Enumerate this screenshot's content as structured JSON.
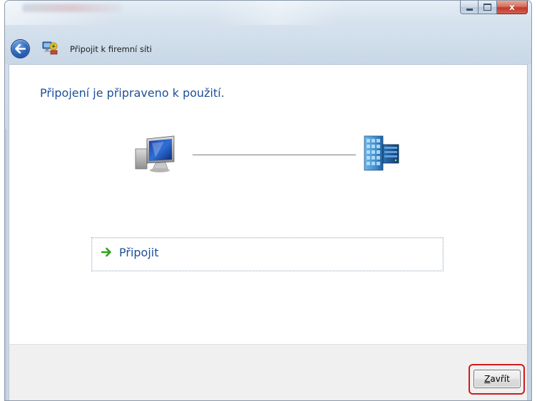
{
  "window": {
    "title": "Připojit k firemní síti",
    "caption_buttons": {
      "minimize_icon": "minimize-icon",
      "maximize_icon": "maximize-icon",
      "close_icon": "close-icon",
      "close_glyph": "x"
    }
  },
  "nav": {
    "back_icon": "back-arrow-icon",
    "wizard_icon": "network-wizard-icon"
  },
  "content": {
    "heading": "Připojení je připraveno k použití.",
    "diagram": {
      "left_icon": "computer-icon",
      "right_icon": "server-building-icon"
    },
    "option": {
      "icon": "green-arrow-icon",
      "label": "Připojit"
    }
  },
  "footer": {
    "close_button": {
      "label_mnemonic": "Z",
      "label_rest": "avřít"
    },
    "highlight_color": "#d41a1a"
  },
  "colors": {
    "heading_blue": "#1d4f9a",
    "link_arrow_green": "#2ea31b",
    "frame_blue": "#c8d7e6"
  }
}
